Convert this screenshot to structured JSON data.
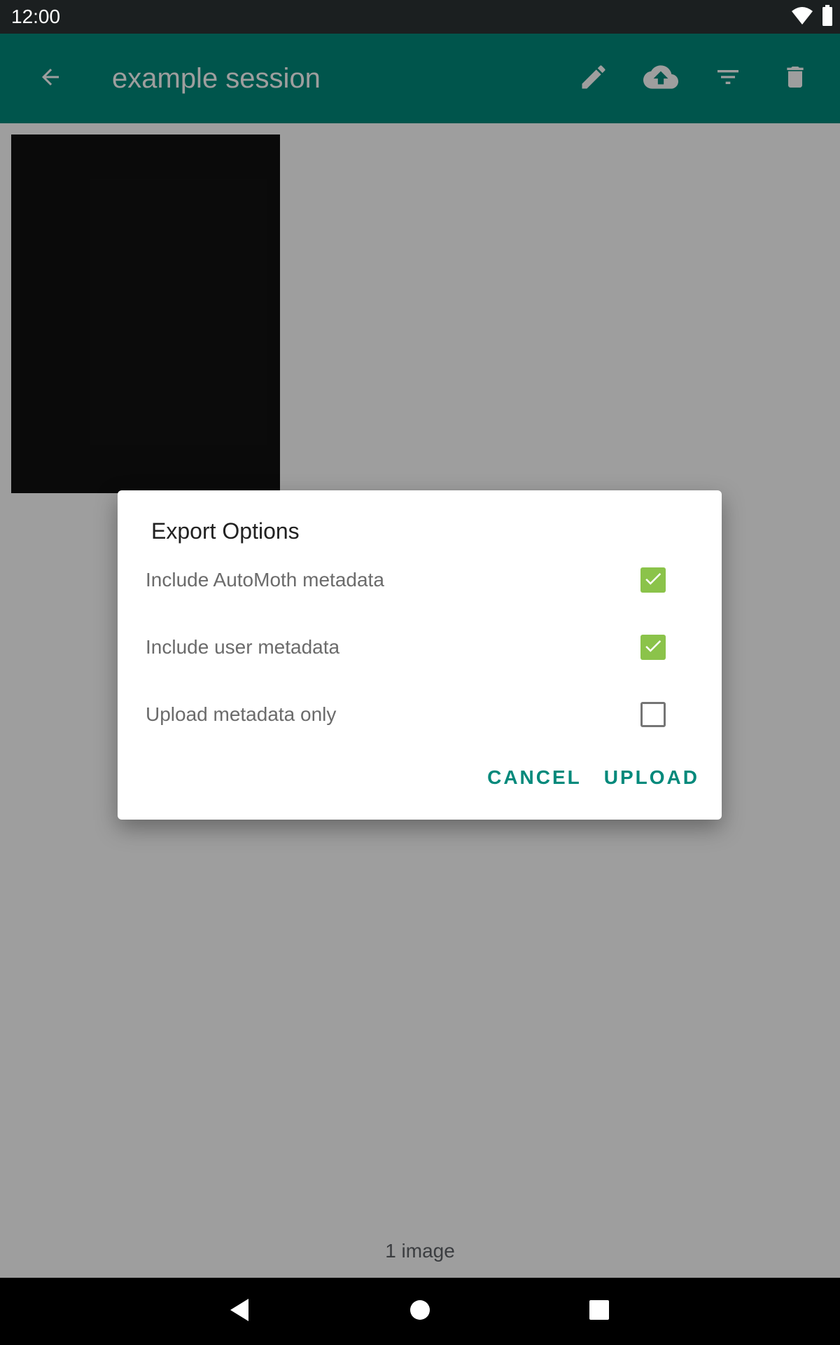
{
  "status_bar": {
    "time": "12:00",
    "icons": [
      "wifi-icon",
      "battery-icon"
    ]
  },
  "app_bar": {
    "title": "example session",
    "actions": [
      "back-arrow-icon",
      "edit-pencil-icon",
      "cloud-upload-icon",
      "filter-icon",
      "delete-trash-icon"
    ],
    "color": "#00897b"
  },
  "content": {
    "footer_count": "1 image"
  },
  "dialog": {
    "title": "Export Options",
    "options": [
      {
        "label": "Include AutoMoth metadata",
        "checked": true
      },
      {
        "label": "Include user metadata",
        "checked": true
      },
      {
        "label": "Upload metadata only",
        "checked": false
      }
    ],
    "cancel_label": "CANCEL",
    "upload_label": "UPLOAD",
    "checkbox_color": "#8bc34a",
    "accent_color": "#00897b"
  },
  "nav_bar": {
    "icons": [
      "nav-back-icon",
      "nav-home-icon",
      "nav-recents-icon"
    ]
  }
}
